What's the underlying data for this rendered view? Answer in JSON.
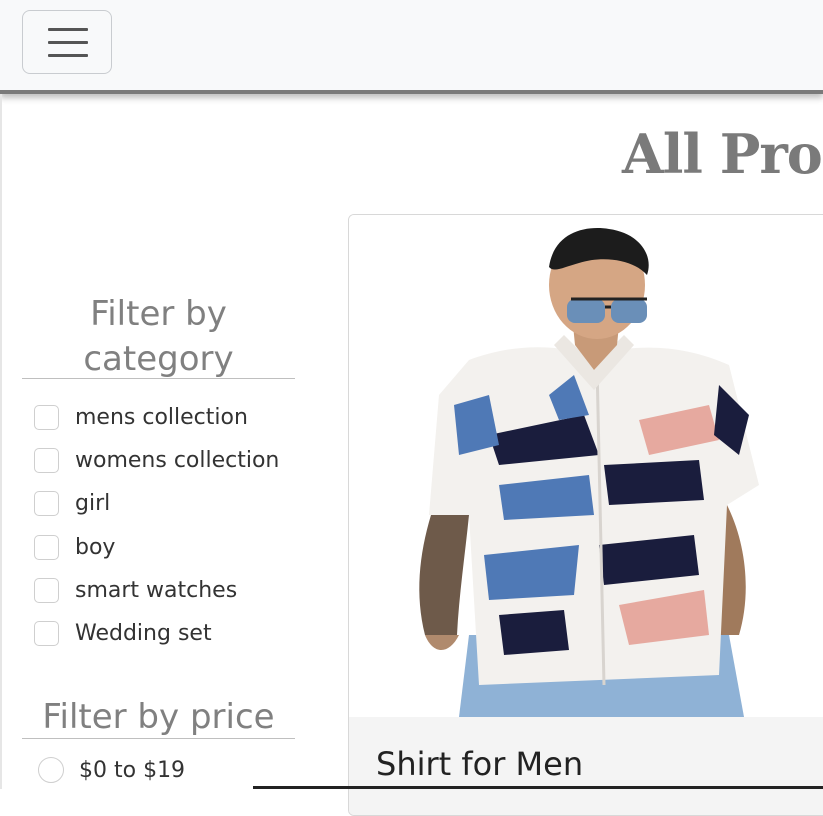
{
  "navbar": {
    "toggler": "hamburger-menu-icon"
  },
  "page": {
    "title": "All Prod"
  },
  "filters": {
    "category_heading": "Filter by category",
    "categories": [
      {
        "label": "mens collection",
        "checked": false
      },
      {
        "label": "womens collection",
        "checked": false
      },
      {
        "label": "girl",
        "checked": false
      },
      {
        "label": "boy",
        "checked": false
      },
      {
        "label": "smart watches",
        "checked": false
      },
      {
        "label": "Wedding set",
        "checked": false
      }
    ],
    "price_heading": "Filter by price",
    "prices": [
      {
        "label": "$0 to $19",
        "selected": false
      }
    ]
  },
  "products": [
    {
      "title": "Shirt for Men",
      "image": "man-in-patterned-shirt-photo"
    }
  ],
  "colors": {
    "navbar_bg": "#f8f9fa",
    "title": "#7a7a7a",
    "heading": "#808080"
  }
}
